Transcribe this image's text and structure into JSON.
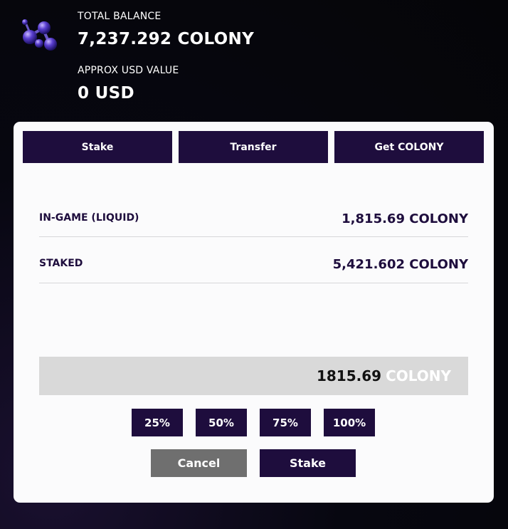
{
  "header": {
    "logo_icon": "colony-molecule-logo-icon",
    "total_balance_label": "TOTAL BALANCE",
    "total_balance_value": "7,237.292 COLONY",
    "usd_label": "APPROX USD VALUE",
    "usd_value": "0 USD"
  },
  "tabs": [
    {
      "label": "Stake"
    },
    {
      "label": "Transfer"
    },
    {
      "label": "Get COLONY"
    }
  ],
  "balances": {
    "ingame_label": "IN-GAME (LIQUID)",
    "ingame_value": "1,815.69 COLONY",
    "staked_label": "STAKED",
    "staked_value": "5,421.602 COLONY"
  },
  "amount_input": {
    "value": "1815.69",
    "unit": "COLONY"
  },
  "percent_buttons": [
    "25%",
    "50%",
    "75%",
    "100%"
  ],
  "actions": {
    "cancel_label": "Cancel",
    "stake_label": "Stake"
  },
  "colors": {
    "accent": "#1e0d3d",
    "cancel": "#6f6f6f",
    "panel": "#fbfbfc",
    "input_bg": "#d9d9d9"
  }
}
